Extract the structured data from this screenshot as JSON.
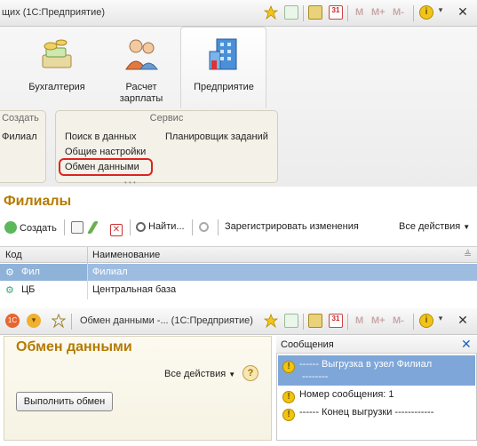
{
  "main_window": {
    "title": "щих  (1С:Предприятие)",
    "toolbar_m": [
      "M",
      "M+",
      "M-"
    ]
  },
  "sections": [
    {
      "label1": "Бухгалтерия",
      "label2": "",
      "icon": "accounting-icon"
    },
    {
      "label1": "Расчет",
      "label2": "зарплаты",
      "icon": "payroll-icon"
    },
    {
      "label1": "Предприятие",
      "label2": "",
      "icon": "enterprise-icon",
      "active": true
    }
  ],
  "groups": {
    "create": {
      "title": "Создать",
      "items": [
        "Филиал"
      ]
    },
    "service": {
      "title": "Сервис",
      "col1": [
        "Поиск в данных",
        "Общие настройки",
        "Обмен данными"
      ],
      "col2": [
        "Планировщик заданий"
      ]
    }
  },
  "list_form": {
    "title": "Филиалы",
    "toolbar": {
      "create": "Создать",
      "find": "Найти...",
      "register": "Зарегистрировать изменения",
      "all_actions": "Все действия"
    },
    "columns": [
      "Код",
      "Наименование"
    ],
    "rows": [
      {
        "code": "Фил",
        "name": "Филиал"
      },
      {
        "code": "ЦБ",
        "name": "Центральная база"
      }
    ]
  },
  "exchange_window": {
    "title": "Обмен данными -...  (1С:Предприятие)",
    "toolbar_m": [
      "M",
      "M+",
      "M-"
    ],
    "heading": "Обмен данными",
    "all_actions": "Все действия",
    "run_button": "Выполнить обмен",
    "messages_title": "Сообщения",
    "messages": [
      "------ Выгрузка в узел Филиал",
      "--------",
      "Номер сообщения: 1",
      "------ Конец выгрузки ------------"
    ]
  },
  "colors": {
    "accent_title": "#b57a00",
    "selection": "#8fb2d9",
    "highlight_border": "#dd2222"
  }
}
